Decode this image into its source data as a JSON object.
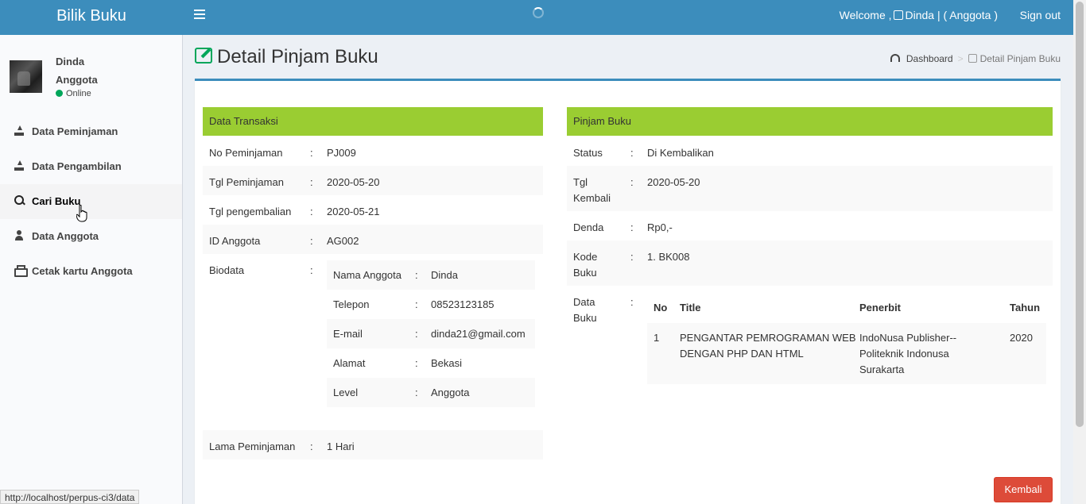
{
  "header": {
    "app_title": "Bilik Buku",
    "welcome_prefix": "Welcome ,",
    "welcome_user": "Dinda | ( Anggota )",
    "signout_label": "Sign out"
  },
  "sidebar": {
    "user_name": "Dinda",
    "user_role": "Anggota",
    "status": "Online",
    "items": [
      {
        "label": "Data Peminjaman"
      },
      {
        "label": "Data Pengambilan"
      },
      {
        "label": "Cari Buku"
      },
      {
        "label": "Data Anggota"
      },
      {
        "label": "Cetak kartu Anggota"
      }
    ]
  },
  "page": {
    "title": "Detail Pinjam Buku",
    "breadcrumb": {
      "home": "Dashboard",
      "current": "Detail Pinjam Buku"
    }
  },
  "transaksi": {
    "heading": "Data Transaksi",
    "no_peminjaman_label": "No Peminjaman",
    "no_peminjaman": "PJ009",
    "tgl_peminjaman_label": "Tgl Peminjaman",
    "tgl_peminjaman": "2020-05-20",
    "tgl_pengembalian_label": "Tgl pengembalian",
    "tgl_pengembalian": "2020-05-21",
    "id_anggota_label": "ID Anggota",
    "id_anggota": "AG002",
    "biodata_label": "Biodata",
    "lama_label": "Lama Peminjaman",
    "lama": "1 Hari",
    "separator": ":"
  },
  "biodata": {
    "nama_label": "Nama Anggota",
    "nama": "Dinda",
    "telepon_label": "Telepon",
    "telepon": "08523123185",
    "email_label": "E-mail",
    "email": "dinda21@gmail.com",
    "alamat_label": "Alamat",
    "alamat": "Bekasi",
    "level_label": "Level",
    "level": "Anggota"
  },
  "pinjam": {
    "heading": "Pinjam Buku",
    "status_label": "Status",
    "status": "Di Kembalikan",
    "tgl_kembali_label_1": "Tgl",
    "tgl_kembali_label_2": "Kembali",
    "tgl_kembali": "2020-05-20",
    "denda_label": "Denda",
    "denda": "Rp0,-",
    "kode_label_1": "Kode",
    "kode_label_2": "Buku",
    "kode": "1. BK008",
    "data_label_1": "Data",
    "data_label_2": "Buku"
  },
  "book_table": {
    "headers": {
      "no": "No",
      "title": "Title",
      "penerbit": "Penerbit",
      "tahun": "Tahun"
    },
    "rows": [
      {
        "no": "1",
        "title_1": "PENGANTAR PEMROGRAMAN WEB",
        "title_2": "DENGAN PHP DAN HTML",
        "penerbit_1": "IndoNusa Publisher--",
        "penerbit_2": "Politeknik Indonusa",
        "penerbit_3": "Surakarta",
        "tahun": "2020"
      }
    ]
  },
  "actions": {
    "kembali_label": "Kembali"
  },
  "statusbar": {
    "url": "http://localhost/perpus-ci3/data"
  },
  "colors": {
    "header": "#3c8dbc",
    "panel_head": "#9acd32",
    "button_danger": "#dd4b39",
    "online": "#00a65a"
  }
}
